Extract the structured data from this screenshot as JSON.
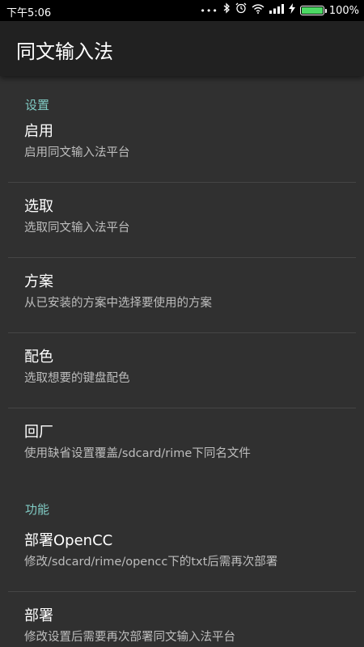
{
  "status_bar": {
    "time": "下午5:06",
    "dots": "•••",
    "battery_percent": "100%",
    "battery_level": 1.0
  },
  "toolbar": {
    "title": "同文输入法"
  },
  "sections": [
    {
      "category": "设置",
      "items": [
        {
          "title": "启用",
          "summary": "启用同文输入法平台"
        },
        {
          "title": "选取",
          "summary": "选取同文输入法平台"
        },
        {
          "title": "方案",
          "summary": "从已安装的方案中选择要使用的方案"
        },
        {
          "title": "配色",
          "summary": "选取想要的键盘配色"
        },
        {
          "title": "回厂",
          "summary": "使用缺省设置覆盖/sdcard/rime下同名文件"
        }
      ]
    },
    {
      "category": "功能",
      "items": [
        {
          "title": "部署OpenCC",
          "summary": "修改/sdcard/rime/opencc下的txt后需再次部署"
        },
        {
          "title": "部署",
          "summary": "修改设置后需要再次部署同文输入法平台"
        }
      ]
    }
  ],
  "colors": {
    "accent": "#80cbc4",
    "toolbar": "#212121",
    "background": "#303030",
    "battery": "#4cd964"
  }
}
